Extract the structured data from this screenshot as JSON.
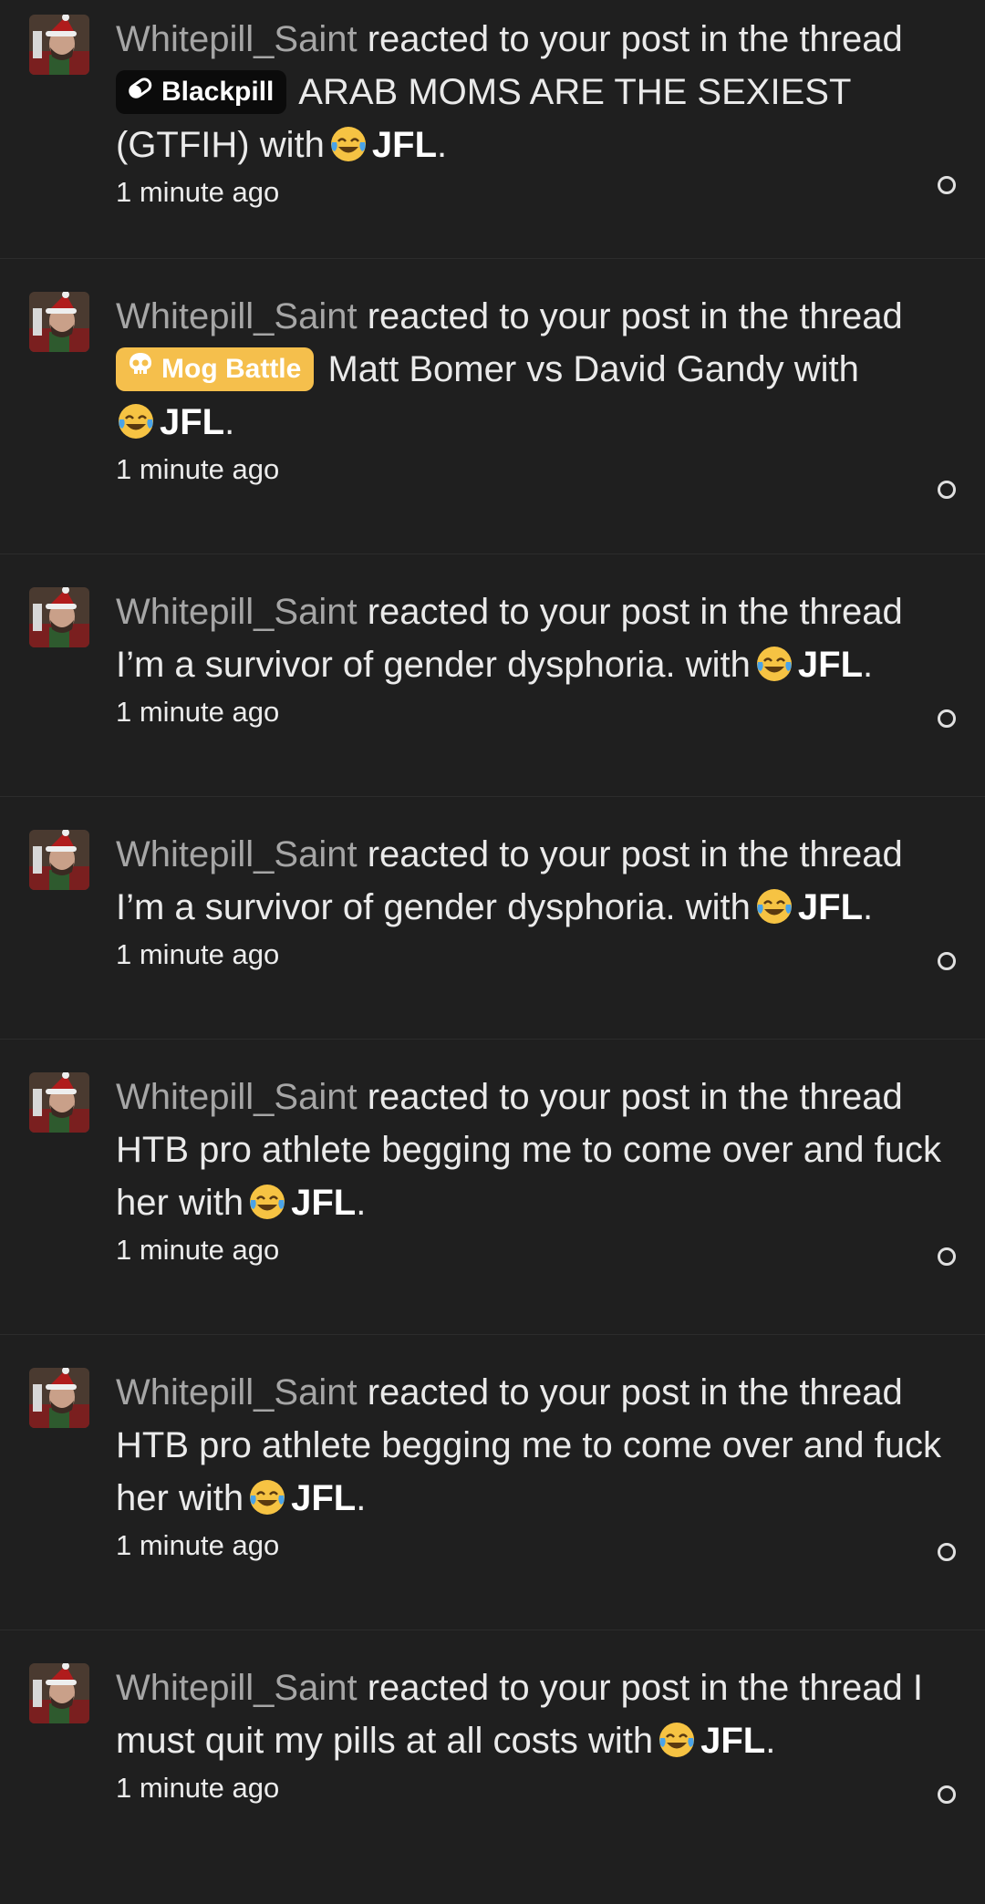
{
  "notifications": [
    {
      "user": "Whitepill_Saint",
      "action": "reacted to your post in the thread",
      "prefix": {
        "label": "Blackpill",
        "style": "dark",
        "icon": "pill-icon"
      },
      "thread": "ARAB MOMS ARE THE SEXIEST (GTFIH)",
      "with": "with",
      "reaction": "JFL",
      "period": ".",
      "time": "1 minute ago"
    },
    {
      "user": "Whitepill_Saint",
      "action": "reacted to your post in the thread",
      "prefix": {
        "label": "Mog Battle",
        "style": "gold",
        "icon": "skull-icon"
      },
      "thread": "Matt Bomer vs David Gandy",
      "with": "with",
      "reaction": "JFL",
      "period": ".",
      "time": "1 minute ago"
    },
    {
      "user": "Whitepill_Saint",
      "action": "reacted to your post in the thread",
      "thread": "I’m a survivor of gender dysphoria.",
      "with": "with",
      "reaction": "JFL",
      "period": ".",
      "time": "1 minute ago"
    },
    {
      "user": "Whitepill_Saint",
      "action": "reacted to your post in the thread",
      "thread": "I’m a survivor of gender dysphoria.",
      "with": "with",
      "reaction": "JFL",
      "period": ".",
      "time": "1 minute ago"
    },
    {
      "user": "Whitepill_Saint",
      "action": "reacted to your post in the thread",
      "thread": "HTB pro athlete begging me to come over and fuck her",
      "with": "with",
      "reaction": "JFL",
      "period": ".",
      "time": "1 minute ago"
    },
    {
      "user": "Whitepill_Saint",
      "action": "reacted to your post in the thread",
      "thread": "HTB pro athlete begging me to come over and fuck her",
      "with": "with",
      "reaction": "JFL",
      "period": ".",
      "time": "1 minute ago"
    },
    {
      "user": "Whitepill_Saint",
      "action": "reacted to your post in the thread",
      "thread": "I must quit my pills at all costs",
      "with": "with",
      "reaction": "JFL",
      "period": ".",
      "time": "1 minute ago"
    }
  ],
  "colors": {
    "background": "#1f1f1f",
    "username": "#a6a6a6",
    "text": "#eaeaea",
    "tag_dark": "#0b0b0b",
    "tag_gold": "#f5bf4c"
  },
  "icons": {
    "avatar": "avatar-santa-hat",
    "reaction_emoji": "face-with-tears-of-joy-icon",
    "unread_marker": "read-status-circle-icon"
  }
}
